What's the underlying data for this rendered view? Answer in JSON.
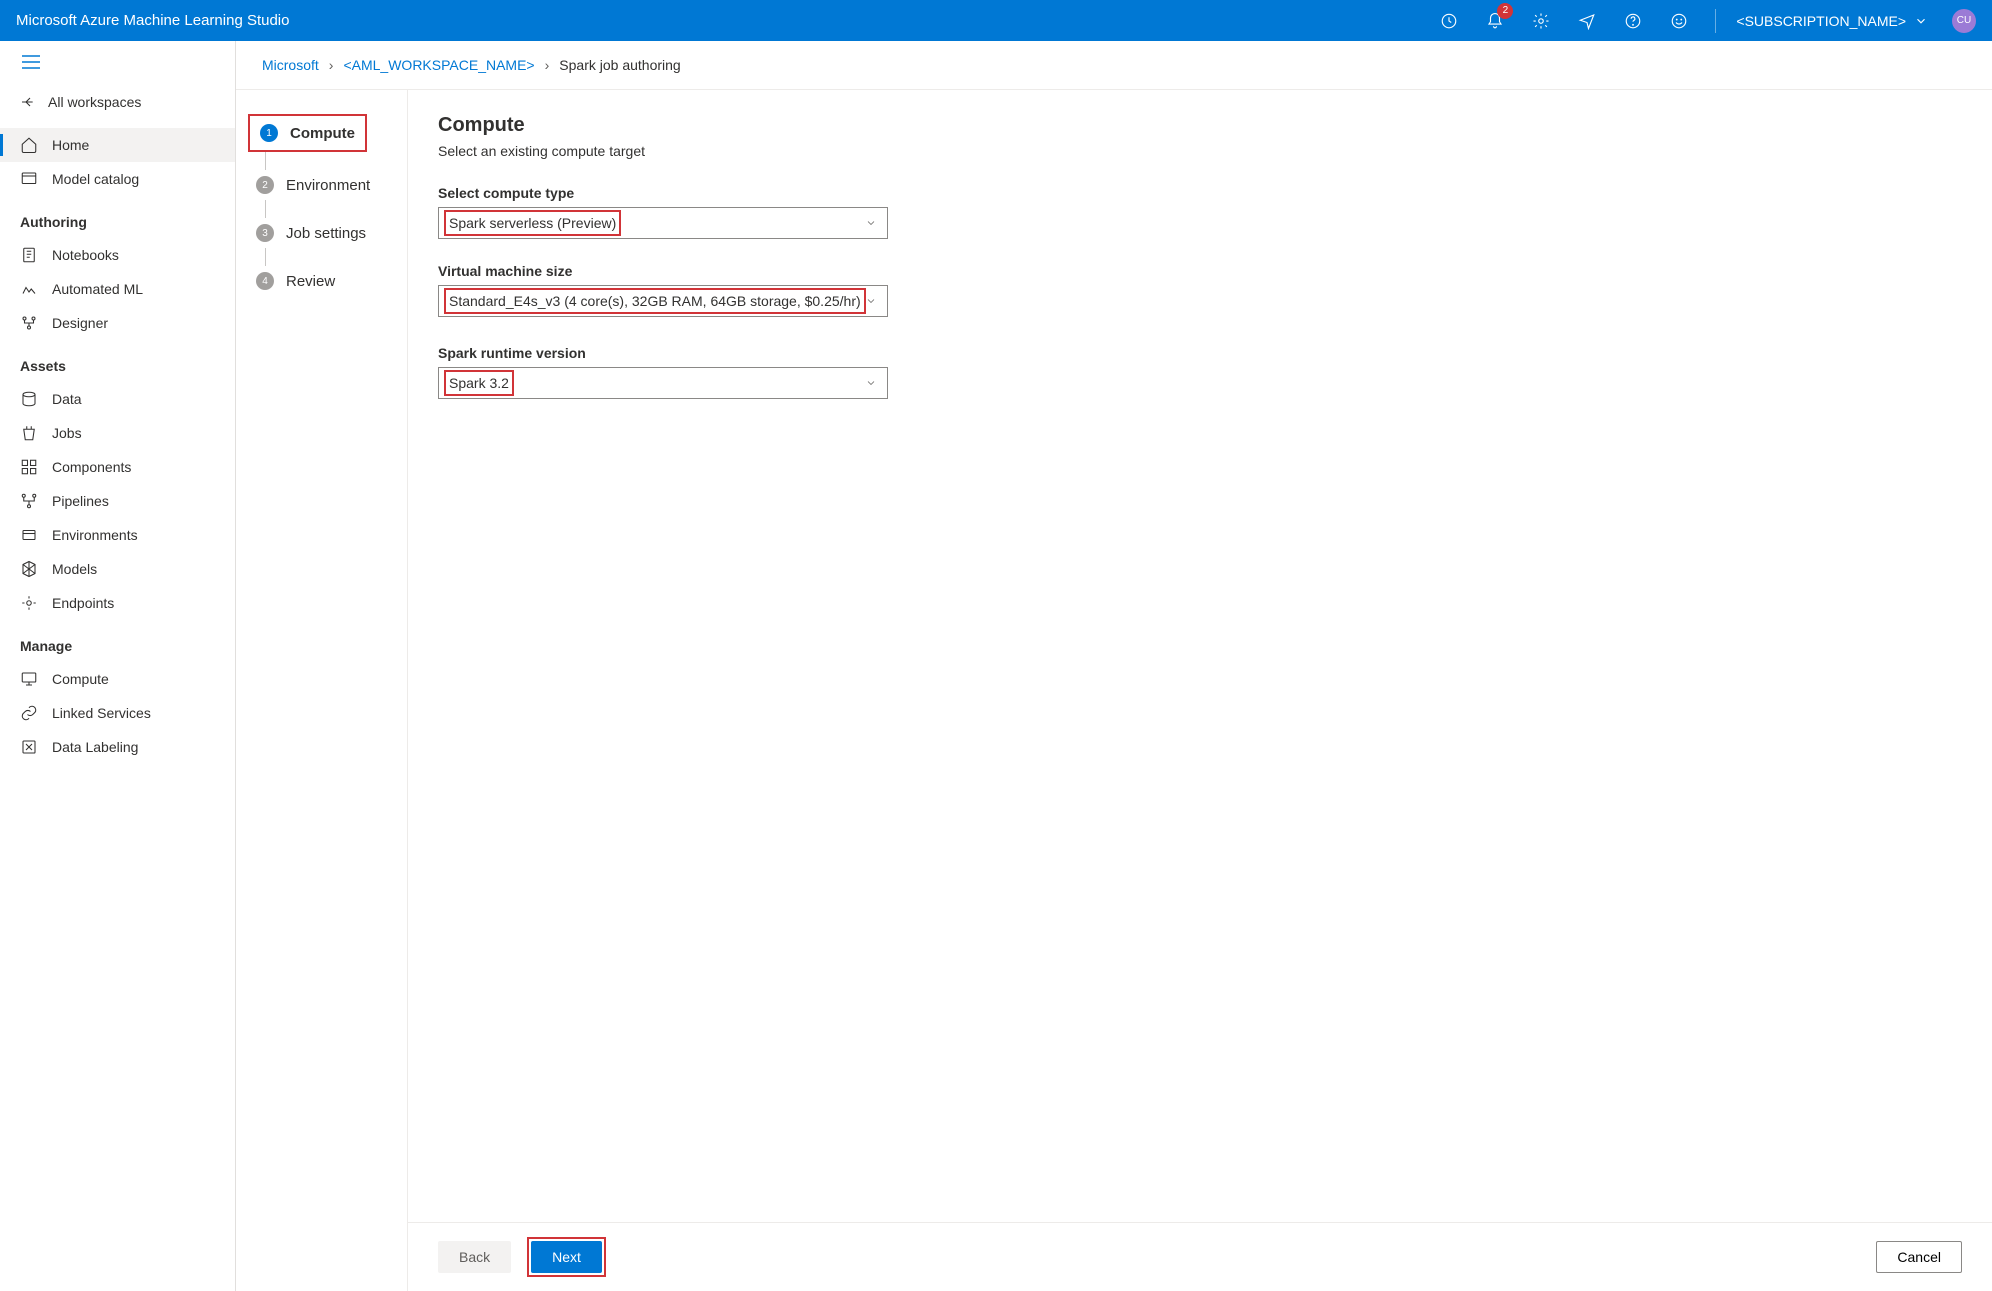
{
  "header": {
    "title": "Microsoft Azure Machine Learning Studio",
    "notification_count": "2",
    "subscription": "<SUBSCRIPTION_NAME>",
    "avatar": "CU"
  },
  "sidebar": {
    "all_workspaces": "All workspaces",
    "items_top": [
      {
        "label": "Home"
      },
      {
        "label": "Model catalog"
      }
    ],
    "sections": [
      {
        "heading": "Authoring",
        "items": [
          {
            "label": "Notebooks"
          },
          {
            "label": "Automated ML"
          },
          {
            "label": "Designer"
          }
        ]
      },
      {
        "heading": "Assets",
        "items": [
          {
            "label": "Data"
          },
          {
            "label": "Jobs"
          },
          {
            "label": "Components"
          },
          {
            "label": "Pipelines"
          },
          {
            "label": "Environments"
          },
          {
            "label": "Models"
          },
          {
            "label": "Endpoints"
          }
        ]
      },
      {
        "heading": "Manage",
        "items": [
          {
            "label": "Compute"
          },
          {
            "label": "Linked Services"
          },
          {
            "label": "Data Labeling"
          }
        ]
      }
    ]
  },
  "breadcrumb": {
    "root": "Microsoft",
    "workspace": "<AML_WORKSPACE_NAME>",
    "current": "Spark job authoring"
  },
  "wizard": {
    "steps": [
      {
        "num": "1",
        "label": "Compute"
      },
      {
        "num": "2",
        "label": "Environment"
      },
      {
        "num": "3",
        "label": "Job settings"
      },
      {
        "num": "4",
        "label": "Review"
      }
    ]
  },
  "panel": {
    "title": "Compute",
    "subtitle": "Select an existing compute target",
    "fields": {
      "compute_type": {
        "label": "Select compute type",
        "value": "Spark serverless (Preview)"
      },
      "vm_size": {
        "label": "Virtual machine size",
        "value": "Standard_E4s_v3 (4 core(s), 32GB RAM, 64GB storage, $0.25/hr)"
      },
      "runtime": {
        "label": "Spark runtime version",
        "value": "Spark 3.2"
      }
    }
  },
  "footer": {
    "back": "Back",
    "next": "Next",
    "cancel": "Cancel"
  }
}
